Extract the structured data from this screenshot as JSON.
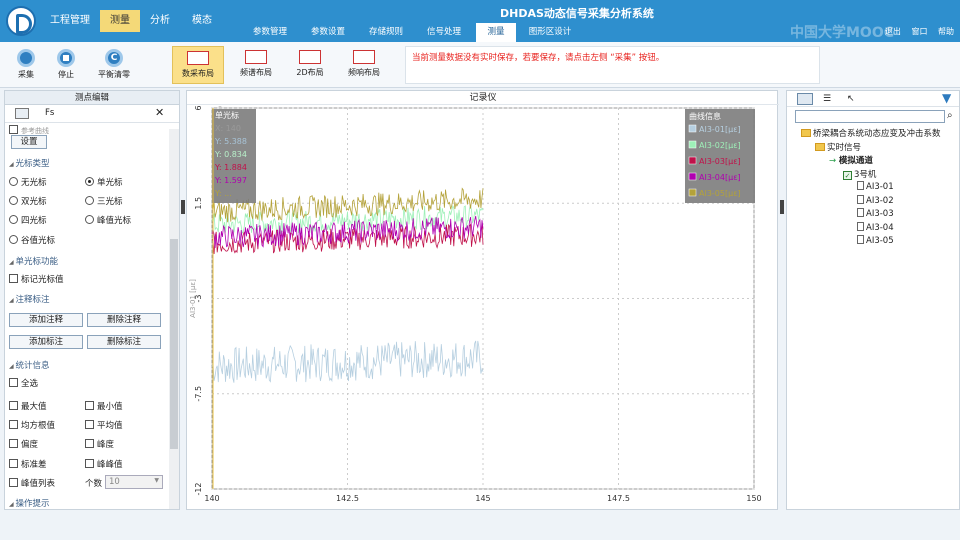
{
  "header": {
    "app_title": "DHDAS动态信号采集分析系统",
    "watermark": "中国大学MOOC",
    "links": [
      "退出",
      "窗口",
      "帮助"
    ],
    "breadcrumb": [
      "工程管理",
      "测量",
      "分析",
      "模态"
    ],
    "tabs": [
      "参数管理",
      "参数设置",
      "存储规则",
      "信号处理",
      "测量",
      "图形区设计"
    ],
    "active_tab": "测量"
  },
  "toolbar": {
    "buttons": [
      "采集",
      "停止",
      "平衡清零"
    ],
    "clear_glyph": "C",
    "layouts": [
      "数采布局",
      "频谱布局",
      "2D布局",
      "频响布局"
    ],
    "active_layout": "数采布局",
    "notice": "当前测量数据没有实时保存，若要保存，请点击左侧 “采集” 按钮。"
  },
  "left": {
    "title": "测点编辑",
    "tabs": [
      "Fs"
    ],
    "partial_item": "参考曲线",
    "setting_button": "设置",
    "cursor_type_title": "光标类型",
    "cursor_types": [
      "无光标",
      "单光标",
      "双光标",
      "三光标",
      "四光标",
      "峰值光标",
      "谷值光标"
    ],
    "cursor_selected": "单光标",
    "single_cursor_title": "单光标功能",
    "single_cursor_opts": [
      "标记光标值"
    ],
    "annotation_title": "注释标注",
    "annotation_buttons": [
      "添加注释",
      "删除注释",
      "添加标注",
      "删除标注"
    ],
    "stats_title": "统计信息",
    "select_all": "全选",
    "stats": [
      "最大值",
      "最小值",
      "均方根值",
      "平均值",
      "偏度",
      "峰度",
      "标准差",
      "峰峰值",
      "峰值列表"
    ],
    "count_label": "个数",
    "count_value": "10",
    "tips": "操作提示"
  },
  "chart_data": {
    "type": "line",
    "title": "记录仪",
    "x_ticks": [
      "140",
      "142.5",
      "145",
      "147.5",
      "150"
    ],
    "y_ticks": [
      "6",
      "1.5",
      "-3",
      "-7.5",
      "-12"
    ],
    "ylabel": "AI3-01 [με]",
    "xlim": [
      140,
      150
    ],
    "ylim": [
      -12,
      6
    ],
    "cursor_box": {
      "title": "单光标",
      "rows": [
        {
          "label": "X: 140",
          "color": "#9a9a9a"
        },
        {
          "label": "Y: 5.388",
          "color": "#a8c3d6"
        },
        {
          "label": "Y: 0.834",
          "color": "#b8f0c9"
        },
        {
          "label": "Y: 1.884",
          "color": "#c0114a"
        },
        {
          "label": "Y: 1.597",
          "color": "#b000b0"
        },
        {
          "label": "Y: ...",
          "color": "#b4a23a"
        }
      ]
    },
    "legend": {
      "title": "曲线信息",
      "items": [
        {
          "name": "AI3-01[με]",
          "color": "#b6cfe0"
        },
        {
          "name": "AI3-02[με]",
          "color": "#9ef0b8"
        },
        {
          "name": "AI3-03[με]",
          "color": "#c0114a"
        },
        {
          "name": "AI3-04[με]",
          "color": "#b000b0"
        },
        {
          "name": "AI3-05[με]",
          "color": "#b4a23a"
        }
      ]
    },
    "series": [
      {
        "name": "AI3-01[με]",
        "color": "#b6cfe0",
        "x": [
          140,
          145
        ],
        "y": [
          -6.2,
          -5.8
        ]
      },
      {
        "name": "AI3-02[με]",
        "color": "#9ef0b8",
        "x": [
          140,
          145
        ],
        "y": [
          0.5,
          0.9
        ]
      },
      {
        "name": "AI3-03[με]",
        "color": "#c0114a",
        "x": [
          140,
          145
        ],
        "y": [
          -0.4,
          0.0
        ]
      },
      {
        "name": "AI3-04[με]",
        "color": "#b000b0",
        "x": [
          140,
          145
        ],
        "y": [
          -0.1,
          0.4
        ]
      },
      {
        "name": "AI3-05[με]",
        "color": "#b4a23a",
        "x": [
          140,
          145
        ],
        "y": [
          1.1,
          1.7
        ]
      }
    ]
  },
  "right": {
    "tree": [
      {
        "label": "桥梁耦合系统动态应变及冲击系数",
        "level": 0,
        "icon": "folder"
      },
      {
        "label": "实时信号",
        "level": 1,
        "icon": "folder"
      },
      {
        "label": "模拟通道",
        "level": 2,
        "icon": "arrow",
        "bold": true
      },
      {
        "label": "3号机",
        "level": 3,
        "icon": "check"
      },
      {
        "label": "AI3-01",
        "level": 4,
        "icon": "doc"
      },
      {
        "label": "AI3-02",
        "level": 4,
        "icon": "doc"
      },
      {
        "label": "AI3-03",
        "level": 4,
        "icon": "doc"
      },
      {
        "label": "AI3-04",
        "level": 4,
        "icon": "doc"
      },
      {
        "label": "AI3-05",
        "level": 4,
        "icon": "doc"
      }
    ]
  }
}
